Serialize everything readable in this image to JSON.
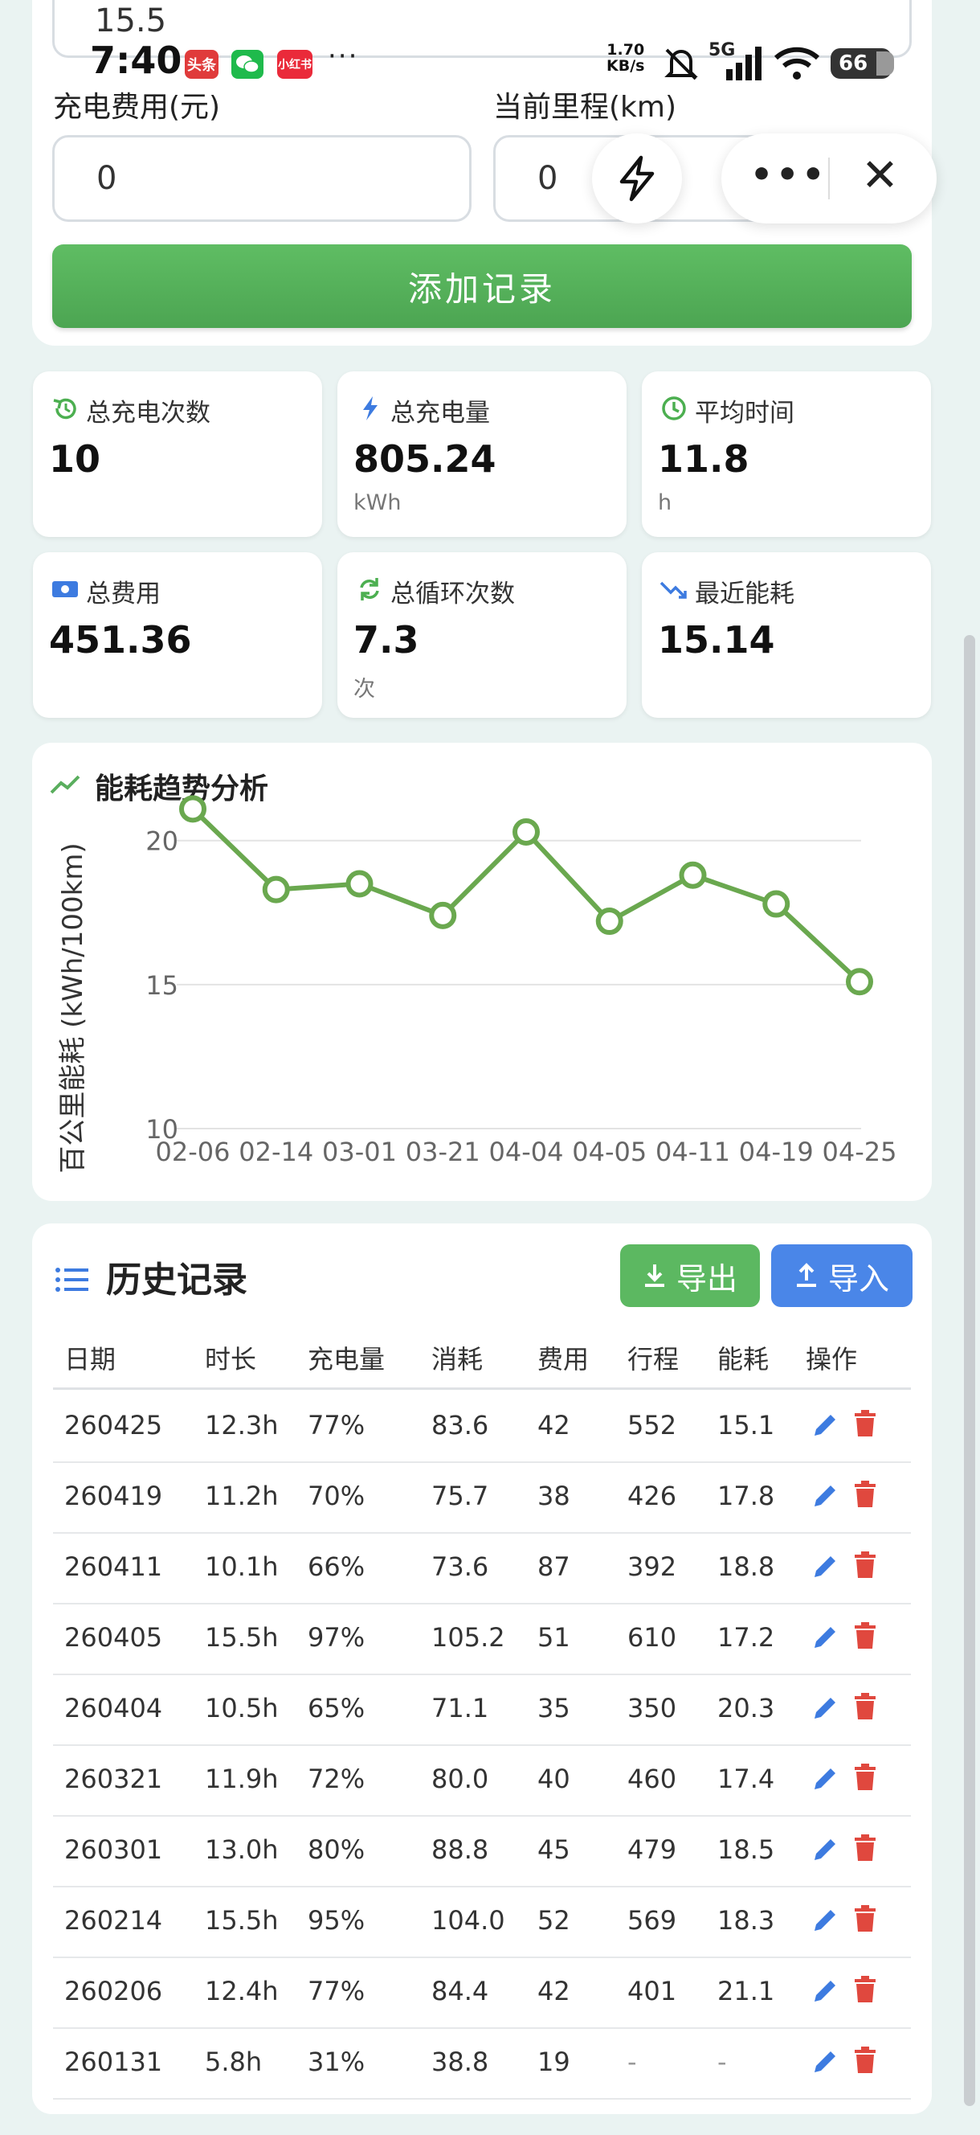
{
  "status": {
    "time": "7:40",
    "badges": [
      {
        "label": "头条",
        "color": "#e03b3b"
      },
      {
        "label": "微信",
        "color": "#1fba4c"
      },
      {
        "label": "小红书",
        "color": "#ea2a3a"
      }
    ],
    "overflow": "···",
    "net_speed": "1.70",
    "net_unit": "KB/s",
    "signal": "5G",
    "battery": "66"
  },
  "form": {
    "prev_value": "15.5",
    "fee_label": "充电费用(元)",
    "fee_value": "0",
    "mileage_label": "当前里程(km)",
    "mileage_value": "0",
    "add_button": "添加记录"
  },
  "stats": [
    {
      "icon": "history-icon",
      "label": "总充电次数",
      "value": "10",
      "unit": "",
      "color": "#4caf50"
    },
    {
      "icon": "bolt-icon",
      "label": "总充电量",
      "value": "805.24",
      "unit": "kWh",
      "color": "#3d7be0"
    },
    {
      "icon": "clock-icon",
      "label": "平均时间",
      "value": "11.8",
      "unit": "h",
      "color": "#4caf50"
    },
    {
      "icon": "money-icon",
      "label": "总费用",
      "value": "451.36",
      "unit": "",
      "color": "#3d7be0"
    },
    {
      "icon": "cycle-icon",
      "label": "总循环次数",
      "value": "7.3",
      "unit": "次",
      "color": "#4caf50"
    },
    {
      "icon": "trend-down-icon",
      "label": "最近能耗",
      "value": "15.14",
      "unit": "",
      "color": "#3d7be0"
    }
  ],
  "chart_title": "能耗趋势分析",
  "chart_data": {
    "type": "line",
    "title": "能耗趋势分析",
    "ylabel": "百公里能耗 (kWh/100km)",
    "xlabel": "",
    "categories": [
      "02-06",
      "02-14",
      "03-01",
      "03-21",
      "04-04",
      "04-05",
      "04-11",
      "04-19",
      "04-25"
    ],
    "values": [
      21.1,
      18.3,
      18.5,
      17.4,
      20.3,
      17.2,
      18.8,
      17.8,
      15.1
    ],
    "yticks": [
      20,
      15,
      10
    ],
    "ylim": [
      10,
      21.5
    ],
    "color": "#6aa84f",
    "grid": true
  },
  "history": {
    "title": "历史记录",
    "export_label": "导出",
    "import_label": "导入",
    "columns": [
      "日期",
      "时长",
      "充电量",
      "消耗",
      "费用",
      "行程",
      "能耗",
      "操作"
    ],
    "rows": [
      [
        "260425",
        "12.3h",
        "77%",
        "83.6",
        "42",
        "552",
        "15.1"
      ],
      [
        "260419",
        "11.2h",
        "70%",
        "75.7",
        "38",
        "426",
        "17.8"
      ],
      [
        "260411",
        "10.1h",
        "66%",
        "73.6",
        "87",
        "392",
        "18.8"
      ],
      [
        "260405",
        "15.5h",
        "97%",
        "105.2",
        "51",
        "610",
        "17.2"
      ],
      [
        "260404",
        "10.5h",
        "65%",
        "71.1",
        "35",
        "350",
        "20.3"
      ],
      [
        "260321",
        "11.9h",
        "72%",
        "80.0",
        "40",
        "460",
        "17.4"
      ],
      [
        "260301",
        "13.0h",
        "80%",
        "88.8",
        "45",
        "479",
        "18.5"
      ],
      [
        "260214",
        "15.5h",
        "95%",
        "104.0",
        "52",
        "569",
        "18.3"
      ],
      [
        "260206",
        "12.4h",
        "77%",
        "84.4",
        "42",
        "401",
        "21.1"
      ],
      [
        "260131",
        "5.8h",
        "31%",
        "38.8",
        "19",
        "-",
        "-"
      ]
    ]
  }
}
